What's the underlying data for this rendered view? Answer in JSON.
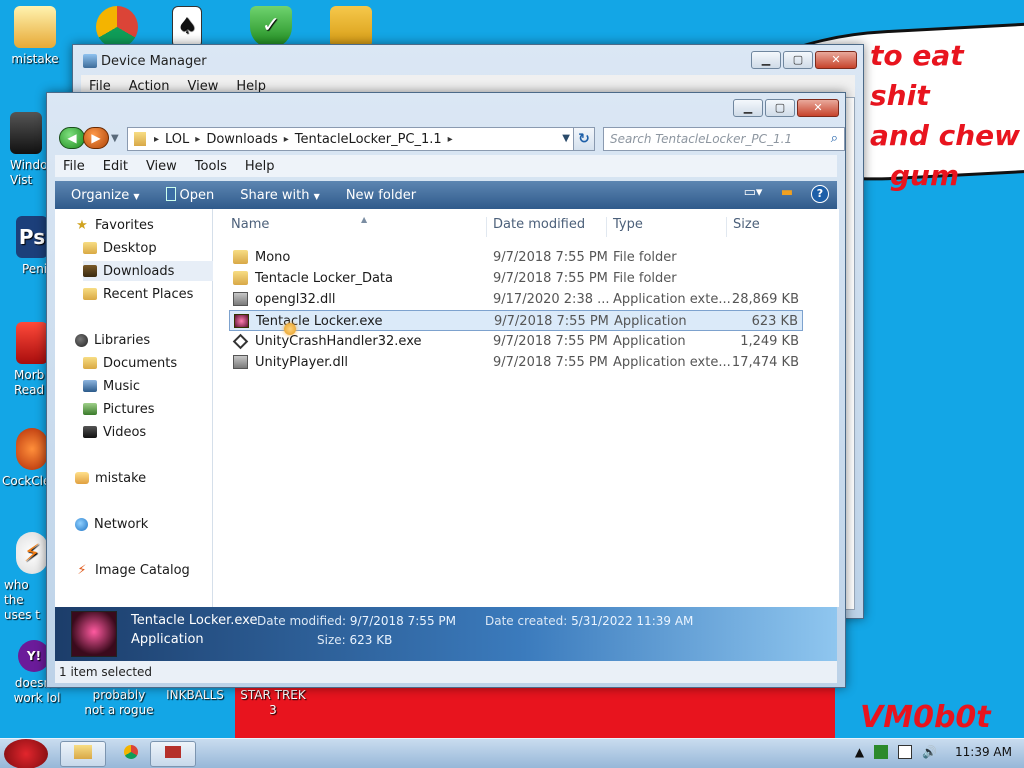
{
  "wallpaper": {
    "bubble_lines": [
      "to eat shit",
      "and chew",
      "gum"
    ],
    "signature": "VM0b0t"
  },
  "desktop_icons": [
    {
      "label": "mistake",
      "icon": "settings-user-icon"
    },
    {
      "label": "Windo\nVist",
      "icon": "trash-icon"
    },
    {
      "label": "Peni",
      "icon": "photoshop-icon"
    },
    {
      "label": "Morb\nRead",
      "icon": "acrobat-icon"
    },
    {
      "label": "CockCle",
      "icon": "ccleaner-icon"
    },
    {
      "label": "who the\nuses t",
      "icon": "avast-icon"
    },
    {
      "label": "doesn't\nwork lol",
      "icon": "yahoo-icon"
    },
    {
      "label": "probably\nnot a rogue",
      "icon": "unknown-icon"
    },
    {
      "label": "INKBALLS",
      "icon": "inkballs-icon"
    },
    {
      "label": "STAR TREK\n3",
      "icon": "startrek-icon"
    }
  ],
  "device_manager": {
    "title": "Device Manager",
    "menu": [
      "File",
      "Action",
      "View",
      "Help"
    ]
  },
  "explorer": {
    "breadcrumb": [
      "LOL",
      "Downloads",
      "TentacleLocker_PC_1.1"
    ],
    "search_placeholder": "Search TentacleLocker_PC_1.1",
    "menu": [
      "File",
      "Edit",
      "View",
      "Tools",
      "Help"
    ],
    "toolbar": {
      "organize": "Organize",
      "open": "Open",
      "share_with": "Share with",
      "new_folder": "New folder"
    },
    "nav": {
      "favorites": "Favorites",
      "desktop": "Desktop",
      "downloads": "Downloads",
      "recent_places": "Recent Places",
      "libraries": "Libraries",
      "documents": "Documents",
      "music": "Music",
      "pictures": "Pictures",
      "videos": "Videos",
      "mistake": "mistake",
      "network": "Network",
      "image_catalog": "Image Catalog"
    },
    "columns": {
      "name": "Name",
      "date_modified": "Date modified",
      "type": "Type",
      "size": "Size"
    },
    "files": [
      {
        "name": "Mono",
        "date": "9/7/2018 7:55 PM",
        "type": "File folder",
        "size": "",
        "icon": "folder-icon"
      },
      {
        "name": "Tentacle Locker_Data",
        "date": "9/7/2018 7:55 PM",
        "type": "File folder",
        "size": "",
        "icon": "folder-icon"
      },
      {
        "name": "opengl32.dll",
        "date": "9/17/2020 2:38 ...",
        "type": "Application exte...",
        "size": "28,869 KB",
        "icon": "dll-icon"
      },
      {
        "name": "Tentacle Locker.exe",
        "date": "9/7/2018 7:55 PM",
        "type": "Application",
        "size": "623 KB",
        "icon": "app-icon"
      },
      {
        "name": "UnityCrashHandler32.exe",
        "date": "9/7/2018 7:55 PM",
        "type": "Application",
        "size": "1,249 KB",
        "icon": "unity-icon"
      },
      {
        "name": "UnityPlayer.dll",
        "date": "9/7/2018 7:55 PM",
        "type": "Application exte...",
        "size": "17,474 KB",
        "icon": "dll-icon"
      }
    ],
    "details": {
      "name": "Tentacle Locker.exe",
      "kind": "Application",
      "date_modified_label": "Date modified:",
      "date_modified": "9/7/2018 7:55 PM",
      "size_label": "Size:",
      "size": "623 KB",
      "date_created_label": "Date created:",
      "date_created": "5/31/2022 11:39 AM"
    },
    "status": "1 item selected"
  },
  "taskbar": {
    "clock": "11:39 AM"
  }
}
